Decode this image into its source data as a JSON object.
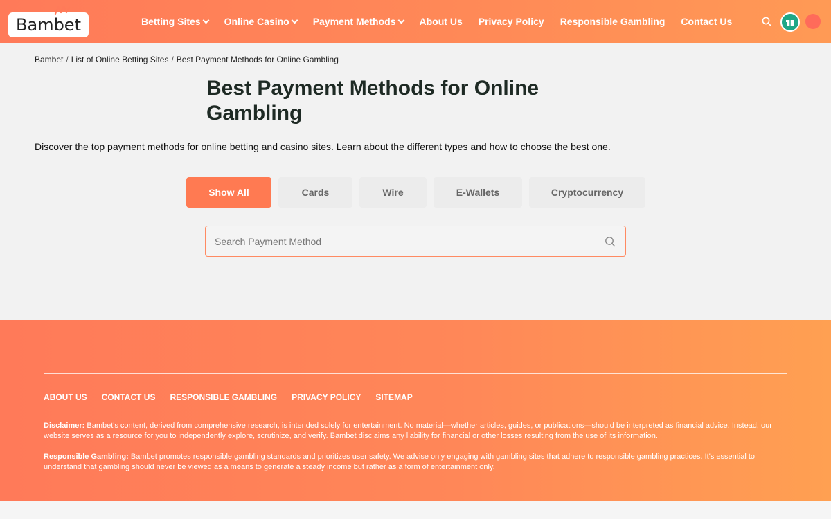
{
  "brand": {
    "logo_text": "Bambet",
    "accent": "#ff7a59",
    "accent_light": "#ffa052",
    "avatar_color": "#1fa787"
  },
  "nav": {
    "items": [
      {
        "label": "Betting Sites",
        "has_dropdown": true
      },
      {
        "label": "Online Casino",
        "has_dropdown": true
      },
      {
        "label": "Payment Methods",
        "has_dropdown": true
      },
      {
        "label": "About Us",
        "has_dropdown": false
      },
      {
        "label": "Privacy Policy",
        "has_dropdown": false
      },
      {
        "label": "Responsible Gambling",
        "has_dropdown": false
      },
      {
        "label": "Contact Us",
        "has_dropdown": false
      }
    ],
    "icons": [
      "search-icon",
      "user-avatar",
      "status-dot"
    ]
  },
  "breadcrumb": [
    "Bambet",
    "List of Online Betting Sites",
    "Best Payment Methods for Online Gambling"
  ],
  "main": {
    "title": "Best Payment Methods for Online Gambling",
    "intro": "Discover the top payment methods for online betting and casino sites. Learn about the different types and how to choose the best one.",
    "filters": [
      {
        "label": "Show All",
        "active": true
      },
      {
        "label": "Cards",
        "active": false
      },
      {
        "label": "Wire",
        "active": false
      },
      {
        "label": "E-Wallets",
        "active": false
      },
      {
        "label": "Cryptocurrency",
        "active": false
      }
    ],
    "search": {
      "placeholder": "Search Payment Method",
      "value": ""
    }
  },
  "footer": {
    "links": [
      "ABOUT US",
      "CONTACT US",
      "RESPONSIBLE GAMBLING",
      "PRIVACY POLICY",
      "SITEMAP"
    ],
    "disclaimer_label": "Disclaimer:",
    "disclaimer_text": " Bambet's content, derived from comprehensive research, is intended solely for entertainment. No material—whether articles, guides, or publications—should be interpreted as financial advice. Instead, our website serves as a resource for you to independently explore, scrutinize, and verify. Bambet disclaims any liability for financial or other losses resulting from the use of its information.",
    "responsible_label": "Responsible Gambling:",
    "responsible_text": " Bambet promotes responsible gambling standards and prioritizes user safety. We advise only engaging with gambling sites that adhere to responsible gambling practices. It's essential to understand that gambling should never be viewed as a means to generate a steady income but rather as a form of entertainment only."
  }
}
